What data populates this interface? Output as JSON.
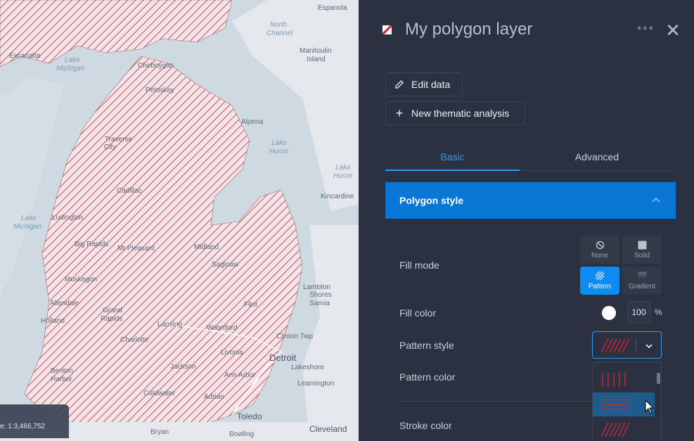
{
  "map": {
    "labels": [
      {
        "text": "Espanola",
        "kind": "place"
      },
      {
        "text": "North",
        "kind": "water"
      },
      {
        "text": "Channel",
        "kind": "water"
      },
      {
        "text": "Escanaba",
        "kind": "place"
      },
      {
        "text": "Manitoulin",
        "kind": "place"
      },
      {
        "text": "Island",
        "kind": "place"
      },
      {
        "text": "Lake",
        "kind": "water"
      },
      {
        "text": "Michigan",
        "kind": "water"
      },
      {
        "text": "Cheboygan",
        "kind": "place"
      },
      {
        "text": "Petoskey",
        "kind": "place"
      },
      {
        "text": "Alpena",
        "kind": "place"
      },
      {
        "text": "Traverse",
        "kind": "place"
      },
      {
        "text": "City",
        "kind": "place"
      },
      {
        "text": "Lake",
        "kind": "water"
      },
      {
        "text": "Huron",
        "kind": "water"
      },
      {
        "text": "Lake",
        "kind": "water"
      },
      {
        "text": "Huron",
        "kind": "water"
      },
      {
        "text": "Cadillac",
        "kind": "place"
      },
      {
        "text": "Kincardine",
        "kind": "place"
      },
      {
        "text": "Lake",
        "kind": "water"
      },
      {
        "text": "Michigan",
        "kind": "water"
      },
      {
        "text": "Ludington",
        "kind": "place"
      },
      {
        "text": "Big Rapids",
        "kind": "place"
      },
      {
        "text": "Mt Pleasant",
        "kind": "place"
      },
      {
        "text": "Midland",
        "kind": "place"
      },
      {
        "text": "Saginaw",
        "kind": "place"
      },
      {
        "text": "Muskegon",
        "kind": "place"
      },
      {
        "text": "Lambton",
        "kind": "place"
      },
      {
        "text": "Shores",
        "kind": "place"
      },
      {
        "text": "Sarnia",
        "kind": "place"
      },
      {
        "text": "Allendale",
        "kind": "place"
      },
      {
        "text": "Grand",
        "kind": "place"
      },
      {
        "text": "Rapids",
        "kind": "place"
      },
      {
        "text": "Flint",
        "kind": "place"
      },
      {
        "text": "Holland",
        "kind": "place"
      },
      {
        "text": "Lansing",
        "kind": "place"
      },
      {
        "text": "Waterford",
        "kind": "place"
      },
      {
        "text": "Charlotte",
        "kind": "place"
      },
      {
        "text": "Clinton Twp",
        "kind": "place"
      },
      {
        "text": "Livonia",
        "kind": "place"
      },
      {
        "text": "Detroit",
        "kind": "place"
      },
      {
        "text": "Lakeshore",
        "kind": "place"
      },
      {
        "text": "Benton",
        "kind": "place"
      },
      {
        "text": "Harbor",
        "kind": "place"
      },
      {
        "text": "Jackson",
        "kind": "place"
      },
      {
        "text": "Ann Arbor",
        "kind": "place"
      },
      {
        "text": "Leamington",
        "kind": "place"
      },
      {
        "text": "Coldwater",
        "kind": "place"
      },
      {
        "text": "Adrian",
        "kind": "place"
      },
      {
        "text": "Toledo",
        "kind": "place"
      },
      {
        "text": "Cleveland",
        "kind": "place"
      },
      {
        "text": "Bryan",
        "kind": "place"
      },
      {
        "text": "Bowling",
        "kind": "place"
      }
    ],
    "scale_text": "e: 1:3,466,752"
  },
  "panel": {
    "layer_title": "My polygon layer",
    "more_icon": "more-dots-icon",
    "close_icon": "close-icon",
    "edit_data_label": "Edit data",
    "new_analysis_label": "New thematic analysis",
    "tabs": [
      {
        "label": "Basic",
        "active": true
      },
      {
        "label": "Advanced",
        "active": false
      }
    ],
    "section_title": "Polygon style",
    "fill_mode_label": "Fill mode",
    "fill_modes": [
      {
        "label": "None",
        "icon": "no-fill-icon",
        "active": false
      },
      {
        "label": "Solid",
        "icon": "solid-fill-icon",
        "active": false
      },
      {
        "label": "Pattern",
        "icon": "pattern-fill-icon",
        "active": true
      },
      {
        "label": "Gradient",
        "icon": "gradient-fill-icon",
        "active": false
      }
    ],
    "fill_color_label": "Fill color",
    "fill_color": "#ffffff",
    "opacity_value": "100",
    "percent_sign": "%",
    "pattern_style_label": "Pattern style",
    "pattern_color_label": "Pattern color",
    "stroke_color_label": "Stroke color",
    "pattern_options": [
      {
        "name": "vertical-lines",
        "selected": false
      },
      {
        "name": "horizontal-lines",
        "selected": true
      },
      {
        "name": "diagonal-lines",
        "selected": false
      }
    ]
  },
  "colors": {
    "accent": "#0a77d6",
    "pattern": "#c0283a",
    "panel_bg": "#2b3140"
  }
}
